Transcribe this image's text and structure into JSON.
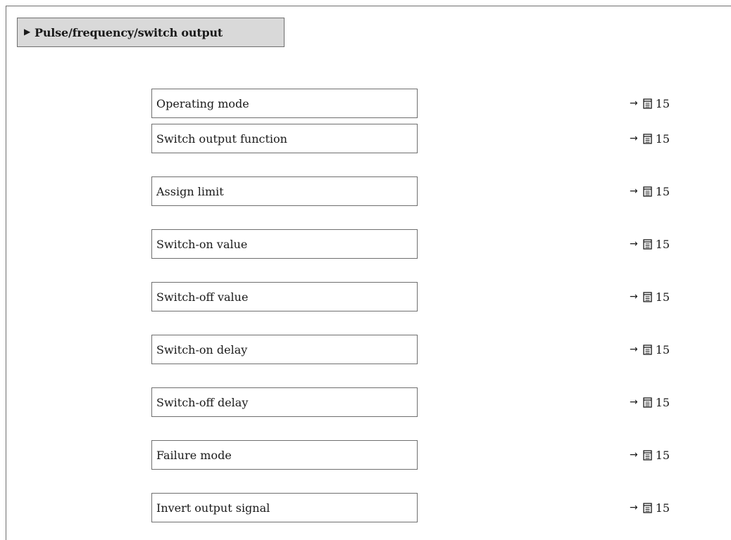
{
  "menu": {
    "arrow": "▶",
    "title": "Pulse/frequency/switch output"
  },
  "parameters": [
    {
      "label": "Operating mode",
      "ref_arrow": "→",
      "ref_page": "15"
    },
    {
      "label": "Switch output function",
      "ref_arrow": "→",
      "ref_page": "15"
    },
    {
      "label": "Assign limit",
      "ref_arrow": "→",
      "ref_page": "15"
    },
    {
      "label": "Switch-on value",
      "ref_arrow": "→",
      "ref_page": "15"
    },
    {
      "label": "Switch-off value",
      "ref_arrow": "→",
      "ref_page": "15"
    },
    {
      "label": "Switch-on delay",
      "ref_arrow": "→",
      "ref_page": "15"
    },
    {
      "label": "Switch-off delay",
      "ref_arrow": "→",
      "ref_page": "15"
    },
    {
      "label": "Failure mode",
      "ref_arrow": "→",
      "ref_page": "15"
    },
    {
      "label": "Invert output signal",
      "ref_arrow": "→",
      "ref_page": "15"
    }
  ],
  "icons": {
    "page_reference": "book-icon"
  }
}
